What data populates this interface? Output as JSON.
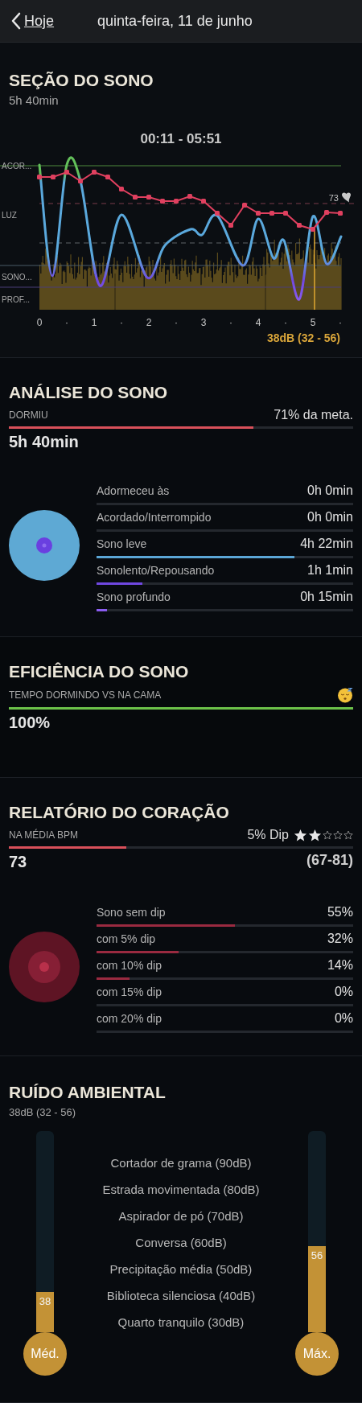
{
  "nav": {
    "back": "Hoje",
    "title": "quinta-feira, 11 de junho"
  },
  "sleep_session": {
    "title": "SEÇÃO DO SONO",
    "duration": "5h 40min",
    "time_range": "00:11 - 05:51",
    "stage_labels": [
      "ACOR...",
      "LUZ",
      "SONO...",
      "PROF..."
    ],
    "x_labels": [
      "0",
      "·",
      "1",
      "·",
      "2",
      "·",
      "3",
      "·",
      "4",
      "·",
      "5",
      "·"
    ],
    "heart_rate_label": "73",
    "noise_reading": "38dB (32 - 56)"
  },
  "sleep_analysis": {
    "title": "ANÁLISE DO SONO",
    "label": "DORMIU",
    "goal": "71% da meta.",
    "level": 0.71,
    "total": "5h 40min",
    "stages": [
      {
        "name": "Adormeceu às",
        "value": "0h 0min"
      },
      {
        "name": "Acordado/Interrompido",
        "value": "0h 0min"
      },
      {
        "name": "Sono leve",
        "value": "4h 22min",
        "level": 0.77,
        "color": "#5ba6d6"
      },
      {
        "name": "Sonolento/Repousando",
        "value": "1h 1min",
        "level": 0.18,
        "color": "#7048e0"
      },
      {
        "name": "Sono profundo",
        "value": "0h 15min",
        "level": 0.04,
        "color": "#8a5cf0"
      }
    ]
  },
  "sleep_efficiency": {
    "title": "EFICIÊNCIA DO SONO",
    "label": "TEMPO DORMINDO VS NA CAMA",
    "level": 1,
    "value": "100%"
  },
  "heart_report": {
    "title": "RELATÓRIO DO CORAÇÃO",
    "label": "NA MÉDIA BPM",
    "dip": "5% Dip",
    "stars": 2,
    "level": 0.34,
    "value": "73",
    "range": "(67-81)",
    "rows": [
      {
        "name": "Sono sem dip",
        "value": "55%",
        "level": 0.54
      },
      {
        "name": "com 5% dip",
        "value": "32%",
        "level": 0.32
      },
      {
        "name": "com 10% dip",
        "value": "14%",
        "level": 0.13
      },
      {
        "name": "com 15% dip",
        "value": "0%"
      },
      {
        "name": "com 20% dip",
        "value": "0%"
      }
    ]
  },
  "ambient_noise": {
    "title": "RUÍDO AMBIENTAL",
    "reading": "38dB (32 - 56)",
    "gauges": [
      {
        "value": "38",
        "label": "Méd.",
        "level": 0.2
      },
      {
        "value": "56",
        "label": "Máx.",
        "level": 0.43
      }
    ],
    "scale": [
      "Cortador de grama (90dB)",
      "Estrada movimentada (80dB)",
      "Aspirador de pó (70dB)",
      "Conversa (60dB)",
      "Precipitação média (50dB)",
      "Biblioteca silenciosa (40dB)",
      "Quarto tranquilo (30dB)"
    ]
  }
}
